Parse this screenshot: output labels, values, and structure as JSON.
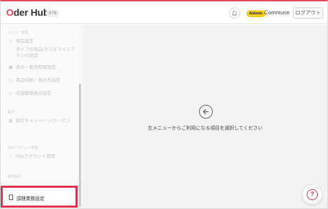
{
  "header": {
    "logo_prefix": "O",
    "logo_main": "der Hub",
    "version": "978",
    "admin_badge": "Admin",
    "user_name": "Commune",
    "logout_label": "ログアウト"
  },
  "sidebar": {
    "sections": [
      {
        "label": "メニュー管理",
        "items": [
          {
            "icon": "store-icon",
            "label": "商品設定",
            "sub": "タイプの商品/カスタマイズプランの設定"
          },
          {
            "icon": "grid-icon",
            "label": "表示・販売時間設定"
          },
          {
            "icon": "print-icon",
            "label": "商品印刷・表示先指定"
          },
          {
            "icon": "tag-icon",
            "label": "店舗情報表示設定"
          }
        ]
      },
      {
        "label": "集計",
        "items": [
          {
            "icon": "chart-icon",
            "label": "割引キャンペーン/クーポン"
          }
        ]
      },
      {
        "label": "Hubアカウント管理",
        "items": [
          {
            "icon": "user-icon",
            "label": "Hubアカウント管理"
          }
        ]
      },
      {
        "label": "端末設定",
        "items": [
          {
            "icon": "device-icon",
            "label": "調理業務設定"
          }
        ]
      }
    ],
    "highlighted_item": "調理業務設定"
  },
  "main": {
    "placeholder_message": "左メニューからご利用になる項目を選択してください",
    "help_symbol": "?"
  },
  "colors": {
    "accent": "#e2304a",
    "badge": "#f5cd1f"
  }
}
